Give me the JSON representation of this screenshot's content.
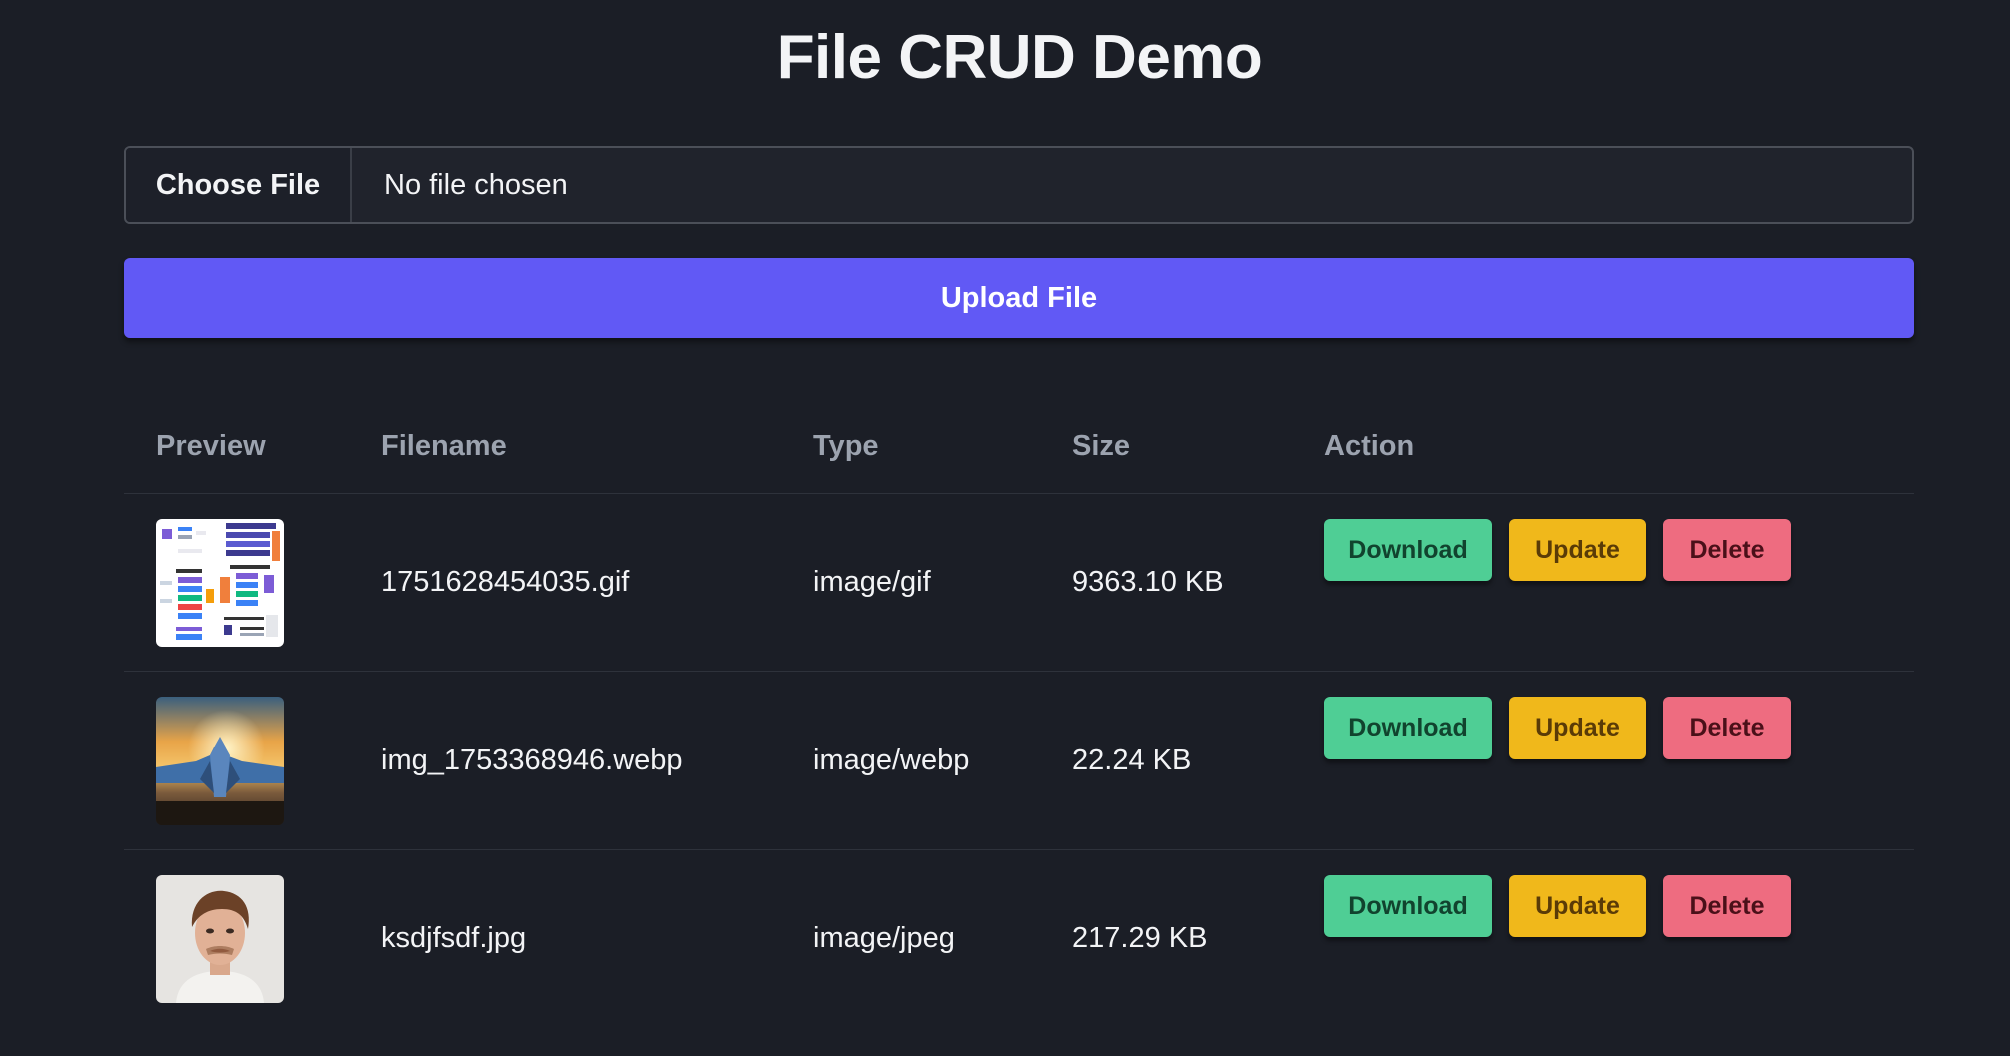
{
  "title": "File CRUD Demo",
  "file_input": {
    "button_label": "Choose File",
    "status": "No file chosen"
  },
  "upload_button": "Upload File",
  "table": {
    "headers": [
      "Preview",
      "Filename",
      "Type",
      "Size",
      "Action"
    ],
    "rows": [
      {
        "filename": "1751628454035.gif",
        "type": "image/gif",
        "size": "9363.10 KB",
        "preview": "diagram-thumbnail"
      },
      {
        "filename": "img_1753368946.webp",
        "type": "image/webp",
        "size": "22.24 KB",
        "preview": "jet-sunset-thumbnail"
      },
      {
        "filename": "ksdjfsdf.jpg",
        "type": "image/jpeg",
        "size": "217.29 KB",
        "preview": "portrait-thumbnail"
      }
    ],
    "actions": {
      "download": "Download",
      "update": "Update",
      "delete": "Delete"
    }
  },
  "colors": {
    "background": "#1b1e26",
    "primary": "#6159f5",
    "download": "#4fce95",
    "update": "#f0b81b",
    "delete": "#ee6c80"
  }
}
